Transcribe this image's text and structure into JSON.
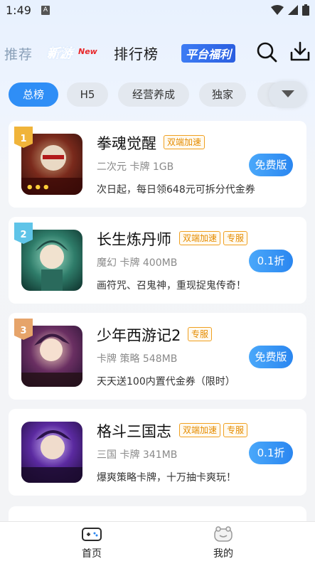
{
  "status_bar": {
    "time": "1:49",
    "notification_letter": "A"
  },
  "header": {
    "nav_recommend": "推荐",
    "nav_new_game": "新游",
    "nav_new_badge": "New",
    "nav_ranking": "排行榜",
    "nav_welfare": "平台福利"
  },
  "tabs": [
    "总榜",
    "H5",
    "经营养成",
    "独家",
    "("
  ],
  "games": [
    {
      "rank": "1",
      "name": "拳魂觉醒",
      "tags": [
        "双端加速"
      ],
      "meta": "二次元 卡牌 1GB",
      "desc": "次日起，每日领648元可拆分代金券",
      "action": "免费版"
    },
    {
      "rank": "2",
      "name": "长生炼丹师",
      "tags": [
        "双端加速",
        "专服"
      ],
      "meta": "魔幻 卡牌 400MB",
      "desc": "画符咒、召鬼神，重现捉鬼传奇！",
      "action": "0.1折"
    },
    {
      "rank": "3",
      "name": "少年西游记2",
      "tags": [
        "专服"
      ],
      "meta": "卡牌 策略 548MB",
      "desc": "天天送100内置代金券（限时）",
      "action": "免费版"
    },
    {
      "rank": "4",
      "name": "格斗三国志",
      "tags": [
        "双端加速",
        "专服"
      ],
      "meta": "三国 卡牌 341MB",
      "desc": "爆爽策略卡牌，十万抽卡爽玩！",
      "action": "0.1折"
    }
  ],
  "bottom_nav": {
    "home": "首页",
    "mine": "我的"
  },
  "colors": {
    "accent": "#2f8ef6",
    "tag_orange": "#e58c00"
  }
}
